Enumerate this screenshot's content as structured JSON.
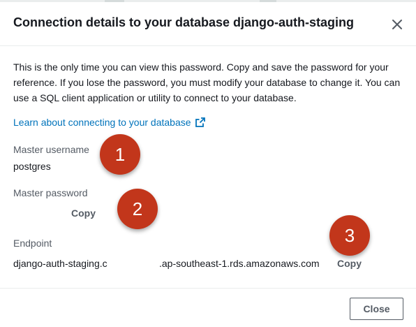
{
  "modal": {
    "title": "Connection details to your database django-auth-staging",
    "close_icon": "close-icon"
  },
  "intro": {
    "text": "This is the only time you can view this password. Copy and save the password for your reference. If you lose the password, you must modify your database to change it. You can use a SQL client application or utility to connect to your database."
  },
  "learn_link": {
    "label": "Learn about connecting to your database",
    "icon": "external-link-icon",
    "color": "#0073bb"
  },
  "fields": {
    "username": {
      "label": "Master username",
      "value": "postgres"
    },
    "password": {
      "label": "Master password",
      "copy_label": "Copy"
    },
    "endpoint": {
      "label": "Endpoint",
      "value_prefix": "django-auth-staging.c",
      "value_suffix": ".ap-southeast-1.rds.amazonaws.com",
      "copy_label": "Copy"
    }
  },
  "badges": {
    "one": "1",
    "two": "2",
    "three": "3",
    "color": "#c2361b"
  },
  "footer": {
    "close_label": "Close"
  }
}
